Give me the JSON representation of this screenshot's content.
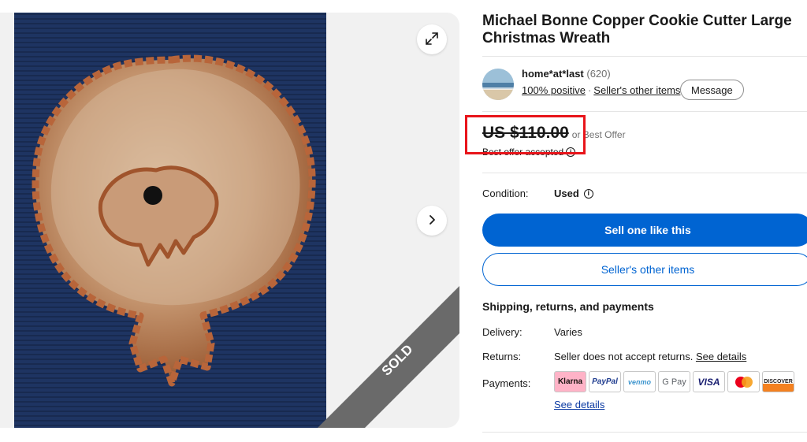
{
  "gallery": {
    "expand_icon": "expand-icon",
    "next_icon": "chevron-right-icon",
    "sold_label": "SOLD"
  },
  "listing": {
    "title": "Michael Bonne Copper Cookie Cutter Large Christmas Wreath"
  },
  "seller": {
    "name": "home*at*last",
    "feedback_count": "(620)",
    "positive": "100% positive",
    "other_items": "Seller's other items",
    "message_label": "Message"
  },
  "price": {
    "amount": "US $110.00",
    "offer_text": "or Best Offer",
    "accepted_text": "Best offer accepted"
  },
  "condition": {
    "label": "Condition:",
    "value": "Used"
  },
  "actions": {
    "sell_label": "Sell one like this",
    "other_items_label": "Seller's other items"
  },
  "shipping": {
    "title": "Shipping, returns, and payments",
    "delivery_label": "Delivery:",
    "delivery_value": "Varies",
    "returns_label": "Returns:",
    "returns_value": "Seller does not accept returns.",
    "returns_link": "See details",
    "payments_label": "Payments:",
    "payments_link": "See details",
    "payment_methods": [
      "Klarna",
      "PayPal",
      "venmo",
      "G Pay",
      "VISA",
      "Mastercard",
      "DISCOVER"
    ]
  },
  "colors": {
    "primary_blue": "#0064d2",
    "highlight_red": "#e8141a",
    "sold_ribbon": "#5f5f5f"
  }
}
